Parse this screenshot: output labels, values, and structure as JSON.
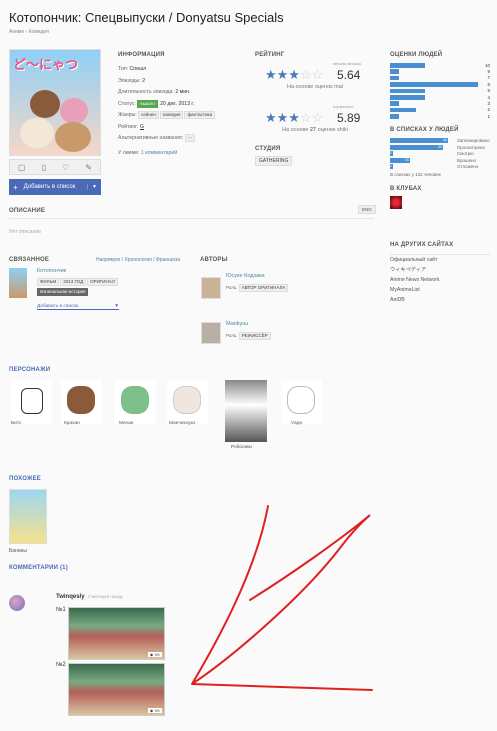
{
  "header": {
    "title": "Котопончик: Спецвыпуски / Donyatsu Specials",
    "breadcrumb": "Аниме › Комедия"
  },
  "cover": {
    "logo_text": "ど～にゃつ"
  },
  "actions": {
    "add_label": "Добавить в список"
  },
  "info": {
    "heading": "ИНФОРМАЦИЯ",
    "type_label": "Тип:",
    "type_value": "Спешл",
    "episodes_label": "Эпизоды:",
    "episodes_value": "2",
    "duration_label": "Длительность эпизода:",
    "duration_value": "2 мин.",
    "status_label": "Статус:",
    "status_badge": "вышло",
    "status_date": "20 дек. 2013 г.",
    "genres_label": "Жанры:",
    "genres": [
      "сейнен",
      "комедия",
      "фантастика"
    ],
    "rating_label": "Рейтинг:",
    "rating_value": "G",
    "alt_names_label": "Альтернативные названия:",
    "alt_names_value": "···",
    "favorites_label": "У лиеме:",
    "favorites_link": "1 комментарий"
  },
  "rating": {
    "heading": "РЕЙТИНГ",
    "mal_note": "весьма весьма",
    "mal_score": "5.64",
    "mal_caption": "На основе оценок mal",
    "shiki_note": "нормально",
    "shiki_score": "5.89",
    "shiki_caption_pre": "На основе",
    "shiki_count": "27",
    "shiki_caption_post": "оценок shiki",
    "mal_stars": 3,
    "shiki_stars": 3
  },
  "studio": {
    "heading": "СТУДИЯ",
    "name": "GATHERING"
  },
  "people_ratings": {
    "heading": "ОЦЕНКИ ЛЮДЕЙ",
    "rows": [
      {
        "score": "10",
        "count": 4
      },
      {
        "score": "9",
        "count": 1
      },
      {
        "score": "7",
        "count": 1
      },
      {
        "score": "6",
        "count": 10
      },
      {
        "score": "5",
        "count": 4
      },
      {
        "score": "4",
        "count": 4
      },
      {
        "score": "3",
        "count": 1
      },
      {
        "score": "2",
        "count": 3
      },
      {
        "score": "1",
        "count": 1
      }
    ]
  },
  "in_lists": {
    "heading": "В СПИСКАХ У ЛЮДЕЙ",
    "rows": [
      {
        "label": "Запланировано",
        "count": 44
      },
      {
        "label": "Просмотрено",
        "count": 40
      },
      {
        "label": "Смотрю",
        "count": 1
      },
      {
        "label": "Брошено",
        "count": 15
      },
      {
        "label": "Отложено",
        "count": 1
      }
    ],
    "total": "В списках у 132 человек"
  },
  "clubs": {
    "heading": "В КЛУБАХ"
  },
  "other_sites": {
    "heading": "НА ДРУГИХ САЙТАХ",
    "items": [
      "Официальный сайт",
      "ウィキペディア",
      "Anime News Network",
      "MyAnimeList",
      "AniDB"
    ]
  },
  "description": {
    "heading": "ОПИСАНИЕ",
    "lang_button": "ENG",
    "empty": "Нет описания"
  },
  "related": {
    "heading": "СВЯЗАННОЕ",
    "views": "Напрямую / Хронология / Франшиза",
    "title": "Котопончик",
    "tags": [
      "ФИЛЬМ",
      "2013 ГОД",
      "ОРИГИНАЛ"
    ],
    "badge": "Изначальная история",
    "add_label": "Добавить в список"
  },
  "authors": {
    "heading": "АВТОРЫ",
    "list": [
      {
        "name": "Юсуке Кодзаки",
        "role_label": "Роль:",
        "role": "АВТОР ОРИГИНАЛА"
      },
      {
        "name": "Mankyuu",
        "role_label": "Роль:",
        "role": "РЕЖИССЁР"
      }
    ]
  },
  "characters": {
    "heading": "ПЕРСОНАЖИ",
    "list": [
      "Битс",
      "Крахан",
      "Мачан",
      "Манчихоукэ",
      "Робосики",
      "Уадн"
    ]
  },
  "similar": {
    "heading": "ПОХОЖЕЕ",
    "list": [
      "Бананы"
    ]
  },
  "comments": {
    "heading": "КОММЕНТАРИИ (1)",
    "user": "Twinqesly",
    "time": "7 месяцев назад",
    "items": [
      {
        "label": "№1",
        "badge": "▶ VK"
      },
      {
        "label": "№2",
        "badge": "▶ VK"
      }
    ]
  }
}
